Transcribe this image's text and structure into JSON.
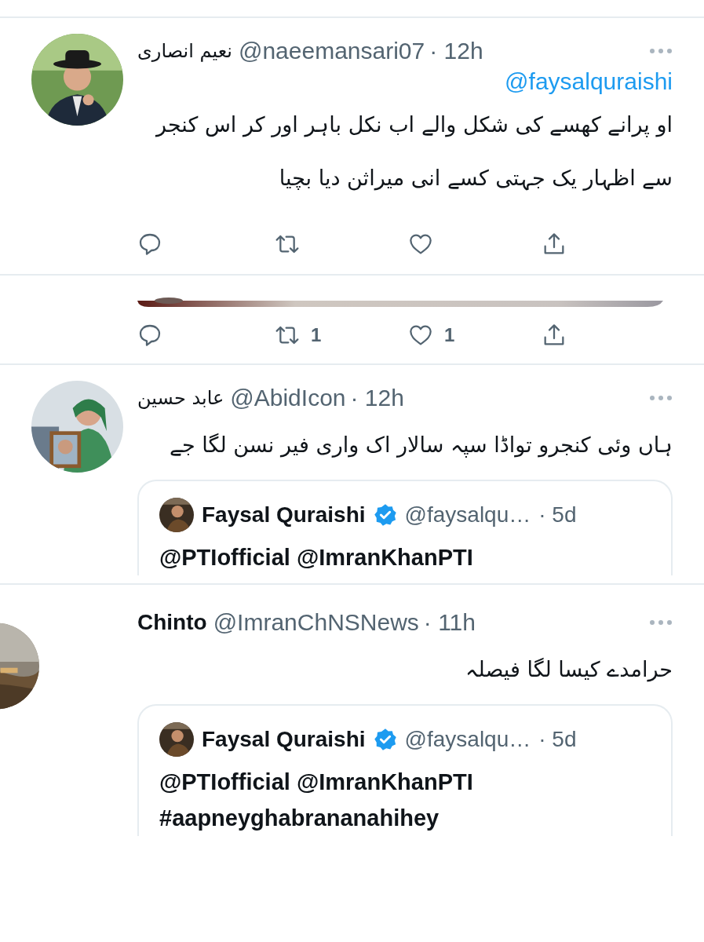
{
  "tweets": [
    {
      "kind": "full",
      "name": "نعیم انصاری",
      "handle": "@naeemansari07",
      "time": "· 12h",
      "reply_to": "@faysalquraishi",
      "text": "او پرانے کھسے کی شکل والے اب نکل باہر اور کر اس کنجر سے اظہار یک جہتی کسے انی میراثن دیا بچیا",
      "actions": [
        {
          "kind": "reply"
        },
        {
          "kind": "retweet"
        },
        {
          "kind": "like"
        },
        {
          "kind": "share"
        }
      ]
    },
    {
      "kind": "fragment",
      "actions": [
        {
          "kind": "reply"
        },
        {
          "kind": "retweet",
          "count": "1"
        },
        {
          "kind": "like",
          "count": "1"
        },
        {
          "kind": "share"
        }
      ]
    },
    {
      "kind": "full",
      "name": "عابد حسین",
      "handle": "@AbidIcon",
      "time": "· 12h",
      "text": "ہاں وئی کنجرو تواڈا سپہ سالار اک واری فیر نسن لگا جے",
      "quote": {
        "name": "Faysal Quraishi",
        "verified": true,
        "handle": "@faysalqu…",
        "time": "· 5d",
        "lines": [
          "@PTIofficial @ImranKhanPTI"
        ]
      }
    },
    {
      "kind": "full",
      "name": "Chinto",
      "handle": "@ImranChNSNews",
      "time": "· 11h",
      "text": "حرامدے کیسا لگا فیصلہ",
      "quote": {
        "name": "Faysal Quraishi",
        "verified": true,
        "handle": "@faysalqu…",
        "time": "· 5d",
        "lines": [
          "@PTIofficial @ImranKhanPTI",
          "#aapneyghabrananahihey"
        ]
      }
    }
  ]
}
